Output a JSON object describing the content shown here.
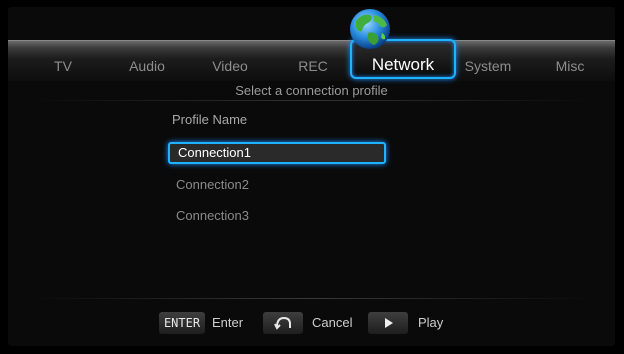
{
  "tabs": [
    "TV",
    "Audio",
    "Video",
    "REC",
    "Network",
    "System",
    "Misc"
  ],
  "active_tab": "Network",
  "subtitle": "Select a connection profile",
  "list": {
    "header": "Profile Name",
    "items": [
      "Connection1",
      "Connection2",
      "Connection3"
    ],
    "selected": "Connection1"
  },
  "hints": {
    "enter_key": "ENTER",
    "enter_label": "Enter",
    "cancel_label": "Cancel",
    "play_label": "Play"
  },
  "colors": {
    "highlight": "#1fb3ff",
    "text_dim": "#8a8a8a"
  },
  "icons": {
    "network_tab": "globe-icon",
    "cancel_key": "return-icon",
    "play_key": "play-icon"
  }
}
